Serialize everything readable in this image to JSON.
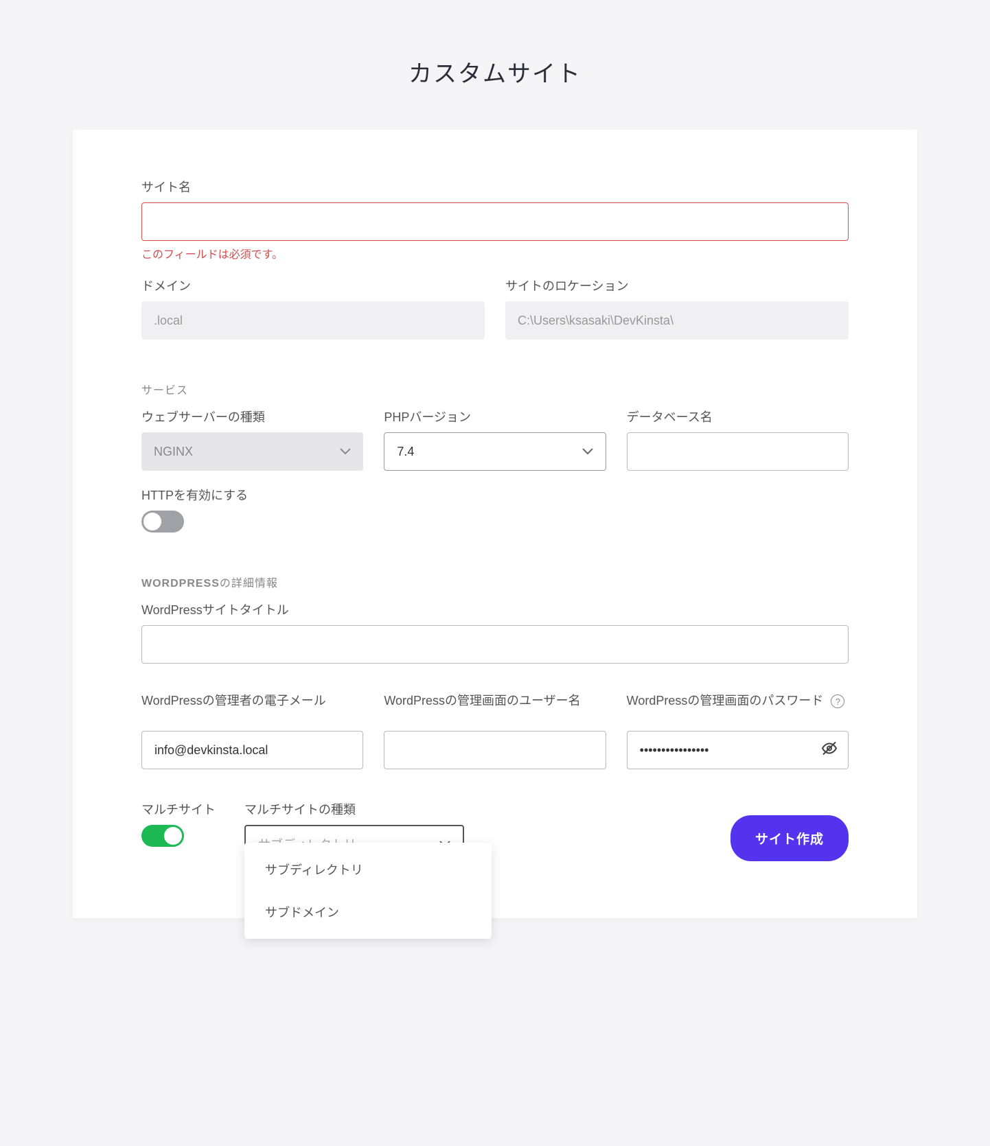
{
  "page_title": "カスタムサイト",
  "site_name": {
    "label": "サイト名",
    "value": "",
    "error": "このフィールドは必須です。"
  },
  "domain": {
    "label": "ドメイン",
    "value": ".local"
  },
  "location": {
    "label": "サイトのロケーション",
    "value": "C:\\Users\\ksasaki\\DevKinsta\\"
  },
  "services_section": "サービス",
  "webserver": {
    "label": "ウェブサーバーの種類",
    "value": "NGINX"
  },
  "php": {
    "label": "PHPバージョン",
    "value": "7.4"
  },
  "dbname": {
    "label": "データベース名",
    "value": ""
  },
  "http_enable": {
    "label": "HTTPを有効にする"
  },
  "wp_section_prefix": "WORDPRESS",
  "wp_section_suffix": "の詳細情報",
  "wp_title": {
    "label": "WordPressサイトタイトル",
    "value": ""
  },
  "wp_email": {
    "label": "WordPressの管理者の電子メール",
    "value": "info@devkinsta.local"
  },
  "wp_user": {
    "label": "WordPressの管理画面のユーザー名",
    "value": ""
  },
  "wp_pass": {
    "label": "WordPressの管理画面のパスワード",
    "value": "••••••••••••••••"
  },
  "multisite": {
    "label": "マルチサイト"
  },
  "multisite_type": {
    "label": "マルチサイトの種類",
    "placeholder": "サブディレクトリ",
    "options": [
      "サブディレクトリ",
      "サブドメイン"
    ]
  },
  "submit": "サイト作成"
}
